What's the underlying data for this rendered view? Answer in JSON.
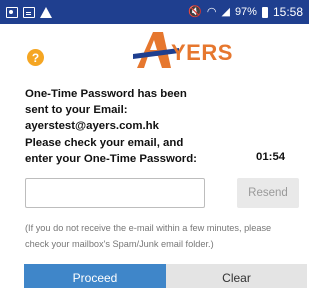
{
  "status_bar": {
    "time": "15:58",
    "battery": "97%",
    "icons": [
      "photo-icon",
      "document-icon",
      "warning-icon",
      "mute-icon",
      "wifi-icon",
      "signal-icon",
      "battery-icon"
    ]
  },
  "header": {
    "logo_text": "YERS",
    "brand_colors": {
      "orange": "#e6772e",
      "blue": "#1f3f8f",
      "help": "#f5a623"
    }
  },
  "message": {
    "lines": [
      "One-Time Password has been",
      "sent to your Email:",
      "ayerstest@ayers.com.hk",
      "Please check your email, and",
      "enter your One-Time Password:"
    ],
    "countdown": "01:54"
  },
  "otp": {
    "value": "",
    "resend_label": "Resend"
  },
  "note": {
    "lines": [
      "(If you do not receive the e-mail within a few minutes, please",
      "check your mailbox's Spam/Junk email folder.)"
    ]
  },
  "actions": {
    "proceed_label": "Proceed",
    "clear_label": "Clear",
    "proceed_color": "#3f86c9"
  }
}
